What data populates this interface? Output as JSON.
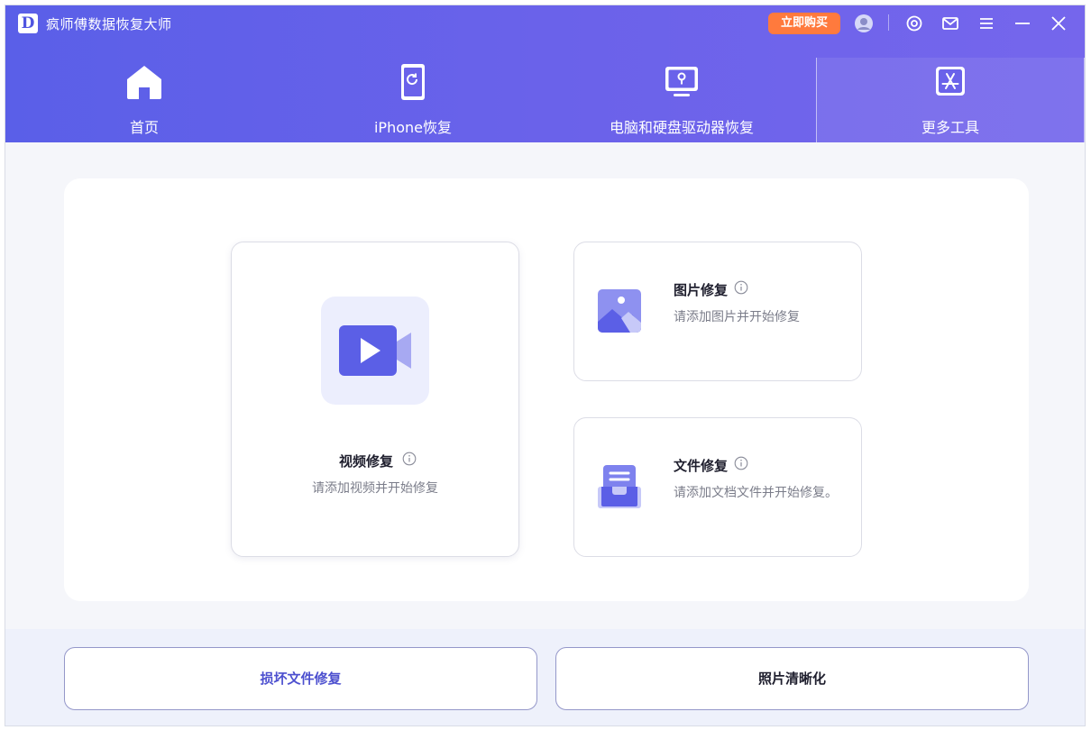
{
  "app": {
    "logo_letter": "D",
    "title": "疯师傅数据恢复大师",
    "buy_label": "立即购买"
  },
  "titlebar_icons": [
    "account-icon",
    "feedback-icon",
    "mail-icon",
    "menu-icon",
    "minimize-icon",
    "close-icon"
  ],
  "nav": {
    "tabs": [
      {
        "label": "首页",
        "icon": "home-icon"
      },
      {
        "label": "iPhone恢复",
        "icon": "iphone-restore-icon"
      },
      {
        "label": "电脑和硬盘驱动器恢复",
        "icon": "computer-disk-icon"
      },
      {
        "label": "更多工具",
        "icon": "app-store-icon",
        "active": true
      }
    ]
  },
  "cards": {
    "video": {
      "title": "视频修复",
      "desc": "请添加视频并开始修复"
    },
    "photo": {
      "title": "图片修复",
      "desc": "请添加图片并开始修复"
    },
    "file": {
      "title": "文件修复",
      "desc": "请添加文档文件并开始修复。"
    }
  },
  "bottom": {
    "repair_label": "损坏文件修复",
    "enhance_label": "照片清晰化"
  },
  "colors": {
    "header_start": "#5a5fe8",
    "header_end": "#7566ec",
    "buy_button": "#ff7a3d",
    "accent": "#4c4fcf"
  }
}
